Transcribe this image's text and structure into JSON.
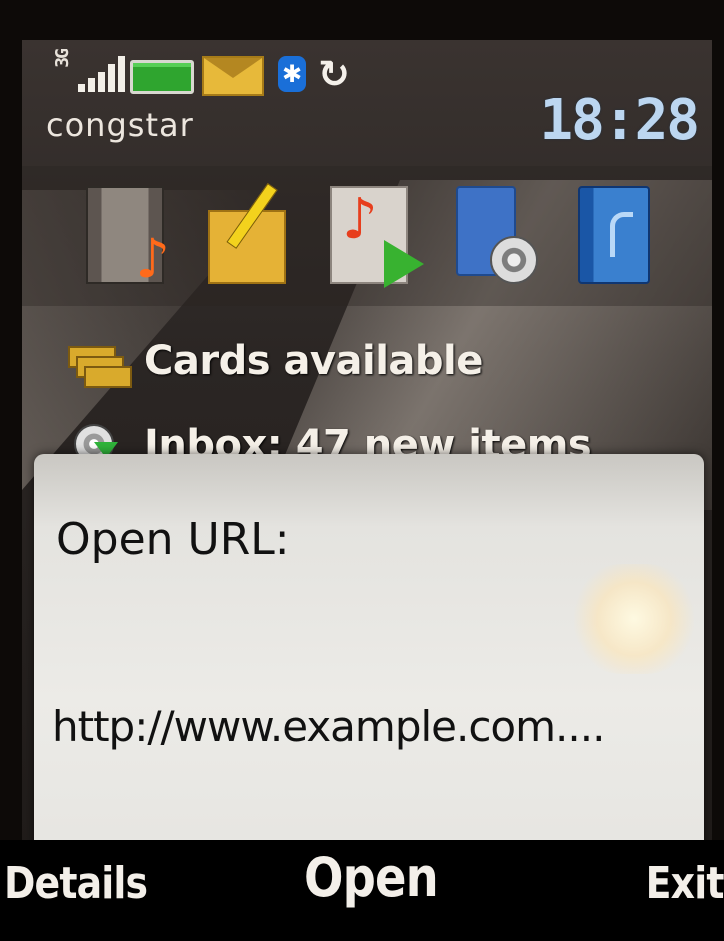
{
  "status_bar": {
    "network_type": "3G",
    "signal_icon": "signal-strength-icon",
    "battery_icon": "battery-icon",
    "message_icon": "message-envelope-icon",
    "bluetooth_icon": "bluetooth-icon",
    "sync_icon": "sync-icon",
    "operator": "congstar",
    "time": "18:28"
  },
  "shortcuts": [
    {
      "icon": "video-music-icon"
    },
    {
      "icon": "write-message-icon"
    },
    {
      "icon": "music-player-icon"
    },
    {
      "icon": "media-device-icon"
    },
    {
      "icon": "contacts-book-icon"
    }
  ],
  "notifications": [
    {
      "icon": "cards-icon",
      "label": "Cards available"
    },
    {
      "icon": "inbox-download-icon",
      "label": "Inbox: 47 new items"
    }
  ],
  "dialog": {
    "title": "Open URL:",
    "url": "http://www.example.com...."
  },
  "softkeys": {
    "left": "Details",
    "middle": "Open",
    "right": "Exit"
  },
  "colors": {
    "clock": "#bcd6f0",
    "battery": "#2fa52f",
    "bluetooth": "#1a6fd8",
    "dialog_bg": "#ecebe7"
  }
}
